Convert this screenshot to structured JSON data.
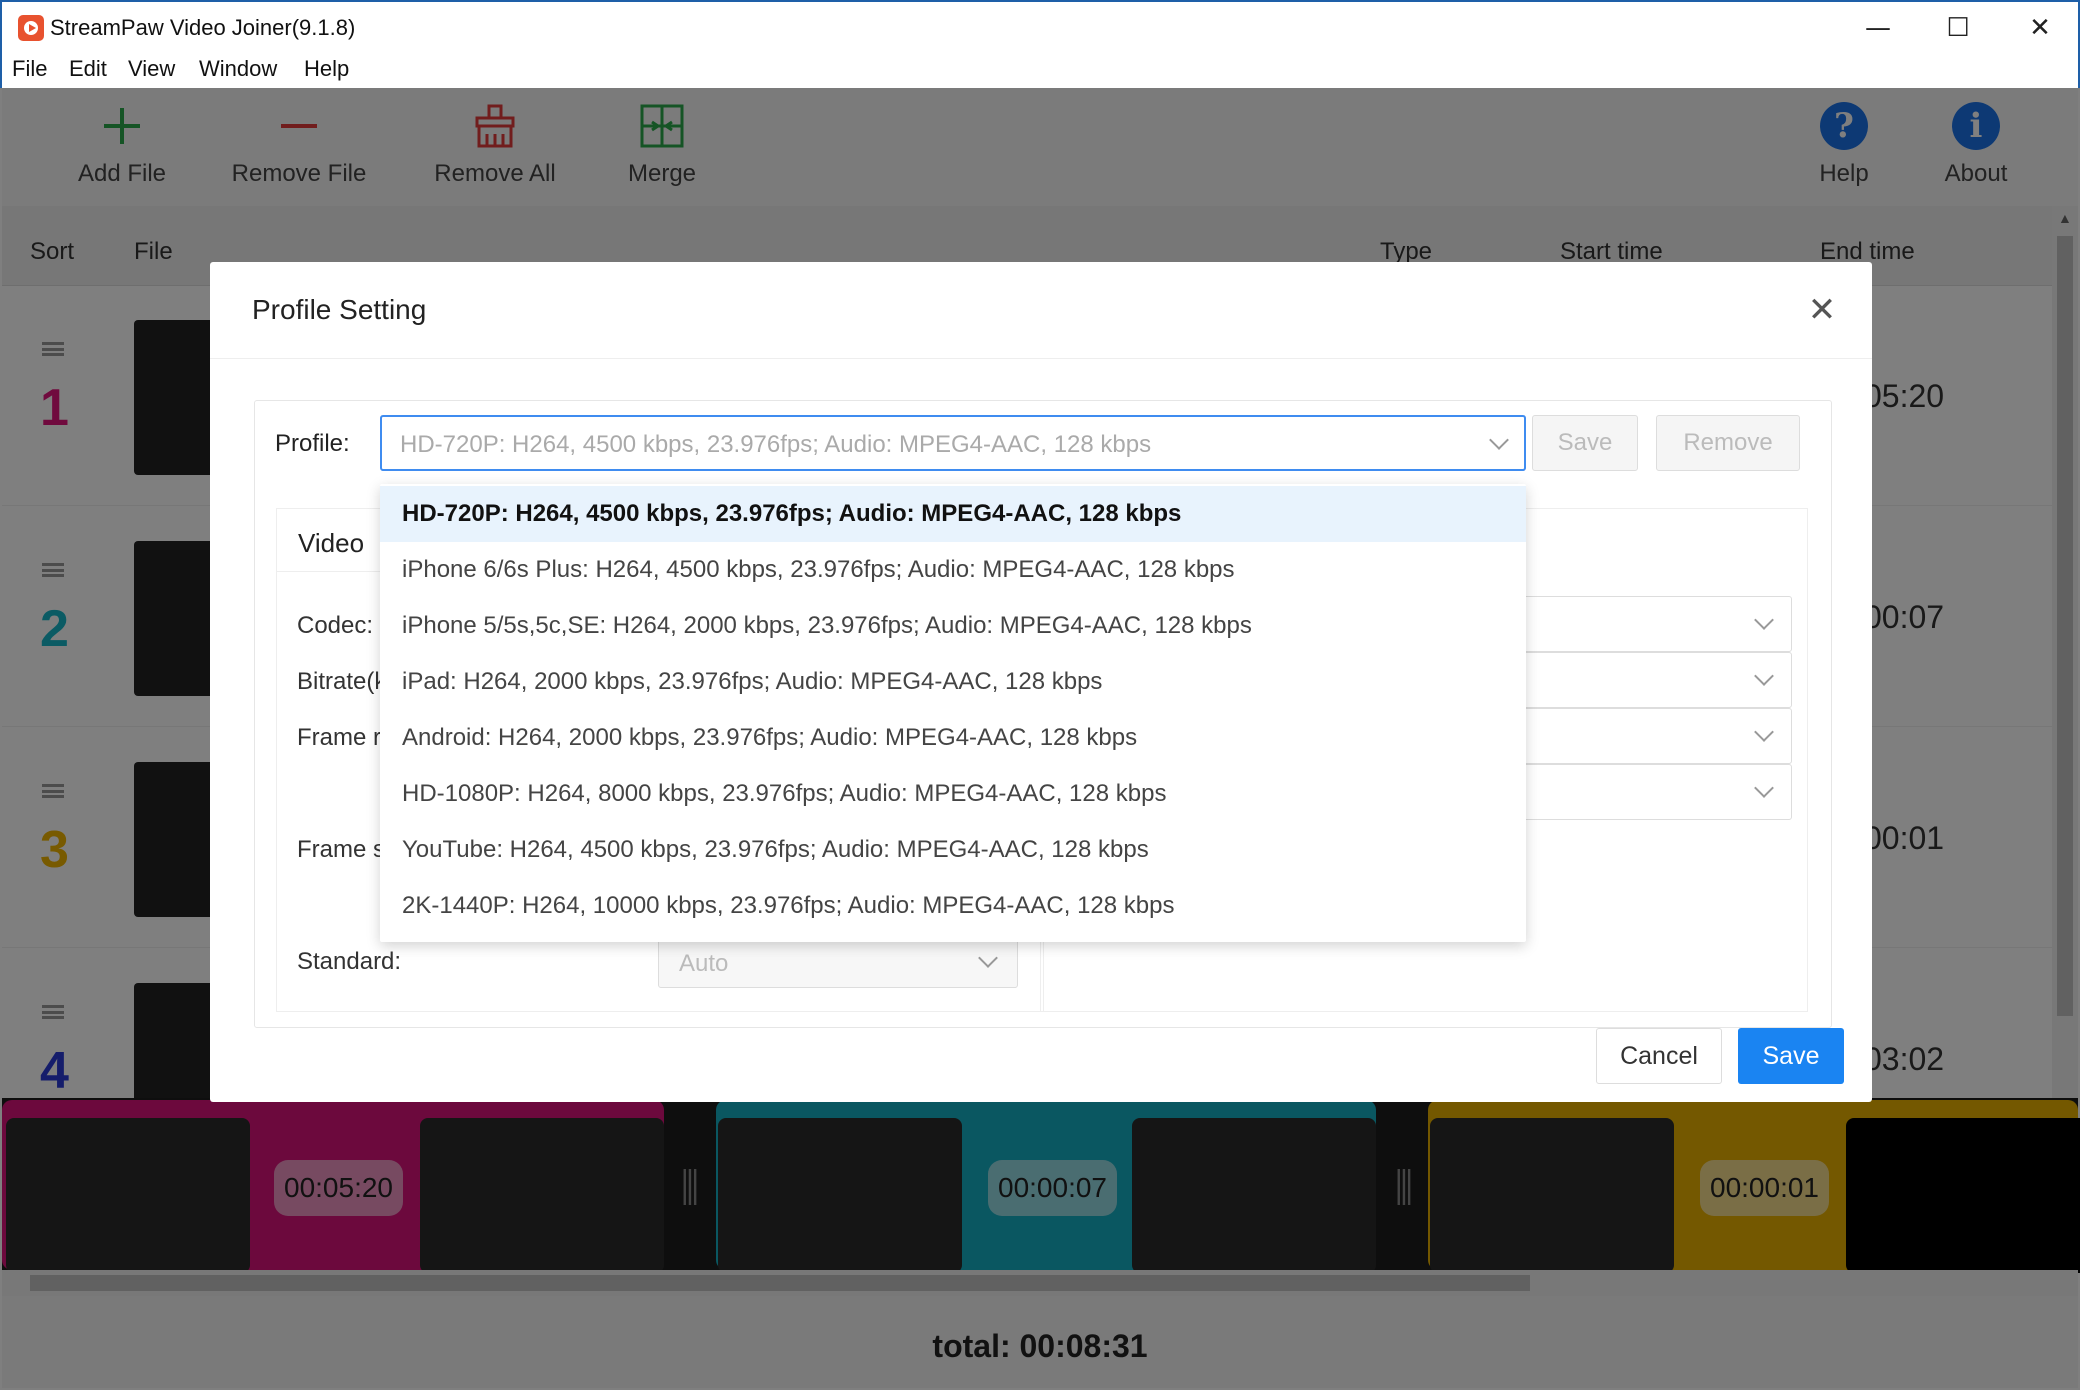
{
  "window": {
    "title": "StreamPaw Video Joiner(9.1.8)",
    "minimize": "—",
    "maximize": "☐",
    "close": "✕"
  },
  "menu": [
    "File",
    "Edit",
    "View",
    "Window",
    "Help"
  ],
  "toolbar": {
    "add_file": "Add File",
    "remove_file": "Remove File",
    "remove_all": "Remove All",
    "merge": "Merge",
    "help": "Help",
    "about": "About"
  },
  "columns": {
    "sort": "Sort",
    "file": "File",
    "type": "Type",
    "start_time": "Start time",
    "end_time": "End time"
  },
  "rows": [
    {
      "num": "1",
      "end": "05:20",
      "color": "#e0147c"
    },
    {
      "num": "2",
      "end": "00:07",
      "color": "#16b6c8"
    },
    {
      "num": "3",
      "end": "00:01",
      "color": "#f0b400"
    },
    {
      "num": "4",
      "end": "03:02",
      "color": "#2a3bd6"
    }
  ],
  "timeline": {
    "durations": [
      "00:05:20",
      "00:00:07",
      "00:00:01"
    ],
    "colors": [
      "#d9137b",
      "#15aec2",
      "#e8b100"
    ]
  },
  "total": "total: 00:08:31",
  "dialog": {
    "title": "Profile Setting",
    "close": "✕",
    "profile_label": "Profile:",
    "profile_value": "HD-720P: H264, 4500 kbps, 23.976fps; Audio: MPEG4-AAC, 128 kbps",
    "save_profile": "Save",
    "remove_profile": "Remove",
    "video_title": "Video",
    "fields": {
      "codec": "Codec:",
      "bitrate": "Bitrate(k",
      "frame_rate": "Frame r",
      "frame_size": "Frame s",
      "standard": "Standard:"
    },
    "standard_value": "Auto",
    "options": [
      "HD-720P: H264, 4500 kbps, 23.976fps; Audio: MPEG4-AAC, 128 kbps",
      "iPhone 6/6s Plus: H264, 4500 kbps, 23.976fps; Audio: MPEG4-AAC, 128 kbps",
      "iPhone 5/5s,5c,SE: H264, 2000 kbps, 23.976fps; Audio: MPEG4-AAC, 128 kbps",
      "iPad: H264, 2000 kbps, 23.976fps; Audio: MPEG4-AAC, 128 kbps",
      "Android: H264, 2000 kbps, 23.976fps; Audio: MPEG4-AAC, 128 kbps",
      "HD-1080P: H264, 8000 kbps, 23.976fps; Audio: MPEG4-AAC, 128 kbps",
      "YouTube: H264, 4500 kbps, 23.976fps; Audio: MPEG4-AAC, 128 kbps",
      "2K-1440P: H264, 10000 kbps, 23.976fps; Audio: MPEG4-AAC, 128 kbps"
    ],
    "cancel": "Cancel",
    "save": "Save"
  }
}
